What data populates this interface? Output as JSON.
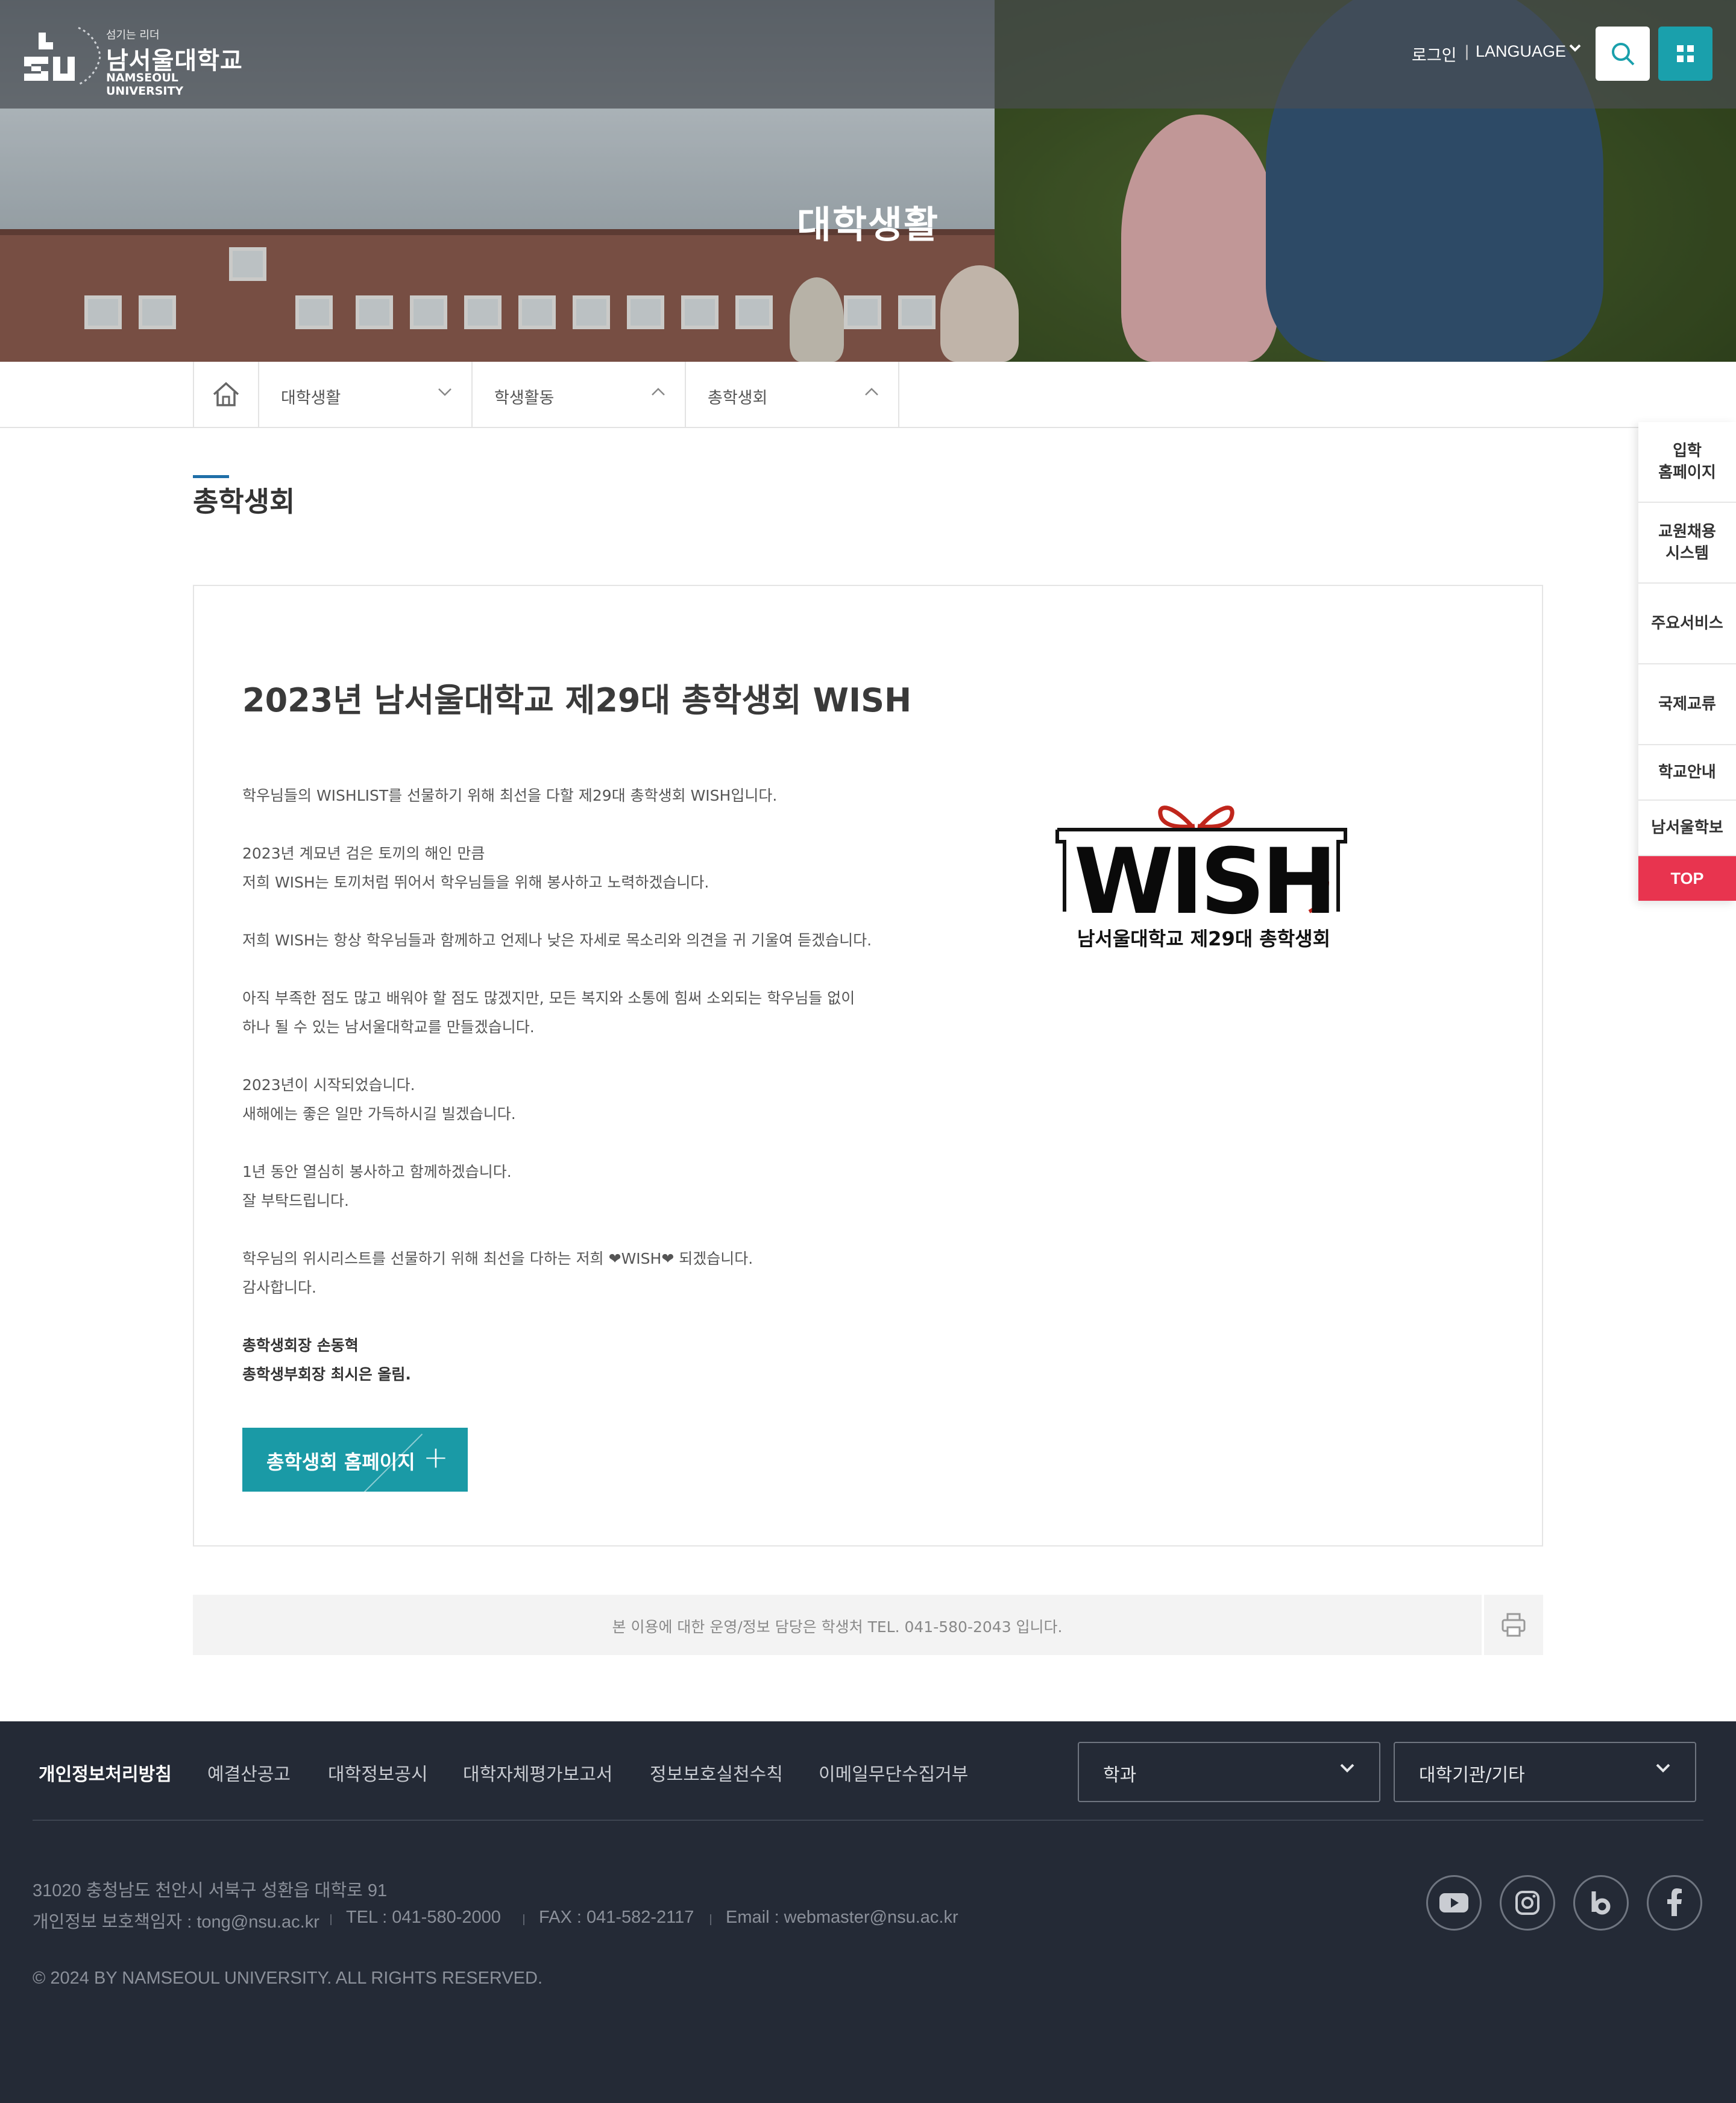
{
  "header": {
    "logo_slogan": "섬기는 리더",
    "logo_name": "남서울대학교",
    "logo_eng": "NAMSEOUL UNIVERSITY",
    "login": "로그인",
    "language": "LANGUAGE",
    "search_icon": "search-icon",
    "apps_icon": "grid-icon"
  },
  "hero": {
    "title": "대학생활"
  },
  "breadcrumb": {
    "home_icon": "home-icon",
    "items": [
      {
        "label": "대학생활",
        "state": "collapsed"
      },
      {
        "label": "학생활동",
        "state": "expanded"
      },
      {
        "label": "총학생회",
        "state": "expanded"
      }
    ]
  },
  "page": {
    "title": "총학생회"
  },
  "content": {
    "heading": "2023년 남서울대학교 제29대 총학생회 WISH",
    "paragraphs": [
      "학우님들의 WISHLIST를 선물하기 위해 최선을 다할 제29대 총학생회 WISH입니다.",
      "2023년 계묘년 검은 토끼의 해인 만큼\n저희 WISH는 토끼처럼 뛰어서 학우님들을 위해 봉사하고 노력하겠습니다.",
      "저희 WISH는 항상 학우님들과 함께하고 언제나 낮은 자세로 목소리와 의견을 귀 기울여 듣겠습니다.",
      "아직 부족한 점도 많고 배워야 할 점도 많겠지만, 모든 복지와 소통에 힘써 소외되는 학우님들 없이\n하나 될 수 있는 남서울대학교를 만들겠습니다.",
      "2023년이 시작되었습니다.\n새해에는 좋은 일만 가득하시길 빌겠습니다.",
      "1년 동안 열심히 봉사하고 함께하겠습니다.\n잘 부탁드립니다.",
      "학우님의 위시리스트를 선물하기 위해 최선을 다하는 저희 ❤WISH❤ 되겠습니다.\n감사합니다."
    ],
    "signature": "총학생회장 손동혁\n총학생부회장 최시은 올림.",
    "button_label": "총학생회 홈페이지",
    "wish_logo_word": "WISH",
    "wish_logo_caption": "남서울대학교 제29대 총학생회",
    "wish_logo_accent": "#c0261c"
  },
  "info": {
    "text": "본 이용에 대한 운영/정보 담당은 학생처 TEL. 041-580-2043 입니다.",
    "print_icon": "print-icon"
  },
  "quick_menu": {
    "items": [
      "입학\n홈페이지",
      "교원채용\n시스템",
      "주요서비스",
      "국제교류",
      "학교안내",
      "남서울학보"
    ],
    "top": "TOP",
    "top_color": "#e8344f"
  },
  "footer": {
    "links": [
      "개인정보처리방침",
      "예결산공고",
      "대학정보공시",
      "대학자체평가보고서",
      "정보보호실천수칙",
      "이메일무단수집거부"
    ],
    "select_dept": "학과",
    "select_org": "대학기관/기타",
    "address": "31020 충청남도 천안시 서북구 성환읍 대학로 91",
    "privacy_officer": "개인정보 보호책임자 : tong@nsu.ac.kr",
    "tel": "TEL : 041-580-2000",
    "fax": "FAX : 041-582-2117",
    "email": "Email : webmaster@nsu.ac.kr",
    "copyright": "© 2024 BY NAMSEOUL UNIVERSITY. ALL RIGHTS RESERVED.",
    "sns": [
      "youtube-icon",
      "instagram-icon",
      "blog-icon",
      "facebook-icon"
    ],
    "background": "#242a36"
  },
  "colors": {
    "accent": "#1a9aa6",
    "title_bar": "#1f6fa8"
  }
}
